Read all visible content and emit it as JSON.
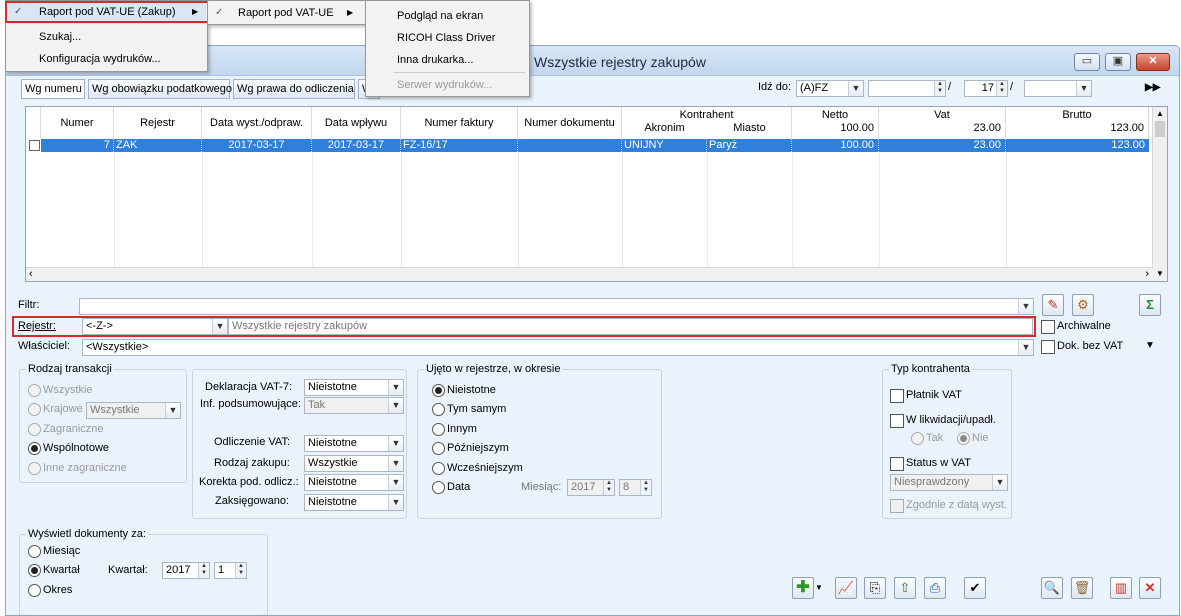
{
  "menu": {
    "level1": {
      "items": [
        {
          "label": "Raport pod VAT-UE (Zakup)",
          "arrow": "▶"
        },
        {
          "label": "Szukaj..."
        },
        {
          "label": "Konfiguracja wydruków..."
        }
      ]
    },
    "level2": {
      "items": [
        {
          "label": "Raport pod VAT-UE",
          "arrow": "▶"
        }
      ]
    },
    "level3": {
      "items": [
        {
          "label": "Podgląd na ekran"
        },
        {
          "label": "RICOH Class Driver"
        },
        {
          "label": "Inna drukarka..."
        },
        {
          "label": "Serwer wydruków..."
        }
      ]
    }
  },
  "window": {
    "title": "Wszystkie rejestry zakupów"
  },
  "tabs": [
    {
      "label": "Wg numeru"
    },
    {
      "label": "Wg obowiązku podatkowego"
    },
    {
      "label": "Wg prawa do odliczenia"
    },
    {
      "label": "W"
    }
  ],
  "goto": {
    "label": "Idź do:",
    "type_value": "(A)FZ",
    "sep1": "/",
    "number": "17",
    "sep2": "/"
  },
  "grid": {
    "headers": {
      "numer": "Numer",
      "rejestr": "Rejestr",
      "data_wyst": "Data wyst./odpraw.",
      "data_wplywu": "Data wpływu",
      "numer_faktury": "Numer faktury",
      "numer_dokumentu": "Numer dokumentu",
      "kontrahent": "Kontrahent",
      "akronim": "Akronim",
      "miasto": "Miasto",
      "netto": "Netto",
      "vat": "Vat",
      "brutto": "Brutto"
    },
    "totals": {
      "netto": "100.00",
      "vat": "23.00",
      "brutto": "123.00"
    },
    "rows": [
      {
        "numer": "7",
        "rejestr": "ZAK",
        "data_wyst": "2017-03-17",
        "data_wplywu": "2017-03-17",
        "numer_faktury": "FZ-16/17",
        "numer_dokumentu": "",
        "akronim": "UNIJNY",
        "miasto": "Paryż",
        "netto": "100.00",
        "vat": "23.00",
        "brutto": "123.00"
      }
    ]
  },
  "filter": {
    "filtr_label": "Filtr:",
    "filtr_value": "",
    "rejestr_label": "Rejestr:",
    "rejestr_value": "<-Z->",
    "rejestr_desc": "Wszystkie rejestry zakupów",
    "wlasciciel_label": "Właściciel:",
    "wlasciciel_value": "<Wszystkie>",
    "archiwalne": "Archiwalne",
    "dok_bez_vat": "Dok. bez VAT"
  },
  "rodzaj": {
    "title": "Rodzaj transakcji",
    "wszystkie": "Wszystkie",
    "krajowe": "Krajowe",
    "krajowe_select": "Wszystkie",
    "zagraniczne": "Zagraniczne",
    "wspolnotowe": "Wspólnotowe",
    "inne": "Inne zagraniczne"
  },
  "deklaracja": {
    "vat7_label": "Deklaracja VAT-7:",
    "vat7_value": "Nieistotne",
    "inf_label": "Inf. podsumowujące:",
    "inf_value": "Tak",
    "odliczenie_label": "Odliczenie VAT:",
    "odliczenie_value": "Nieistotne",
    "rodzaj_label": "Rodzaj zakupu:",
    "rodzaj_value": "Wszystkie",
    "korekta_label": "Korekta pod. odlicz.:",
    "korekta_value": "Nieistotne",
    "zaksiegowano_label": "Zaksięgowano:",
    "zaksiegowano_value": "Nieistotne"
  },
  "ujeto": {
    "title": "Ujęto w rejestrze, w okresie",
    "nieistotne": "Nieistotne",
    "tym": "Tym samym",
    "innym": "Innym",
    "pozniej": "Późniejszym",
    "wczesniej": "Wcześniejszym",
    "data": "Data",
    "miesiac_label": "Miesiąc:",
    "rok": "2017",
    "miesiac": "8"
  },
  "typ": {
    "title": "Typ kontrahenta",
    "platnik": "Płatnik VAT",
    "likwidacja": "W likwidacji/upadł.",
    "tak": "Tak",
    "nie": "Nie",
    "status": "Status w VAT",
    "status_value": "Niesprawdzony",
    "zgodnie": "Zgodnie z datą wyst."
  },
  "wyswietl": {
    "title": "Wyświetl dokumenty za:",
    "miesiac": "Miesiąc",
    "kwartal": "Kwartał",
    "okres": "Okres",
    "kwartal_label": "Kwartał:",
    "rok": "2017",
    "kwartal_value": "1"
  },
  "colors": {
    "accent": "#2f7fdd",
    "highlight_box": "#d42c2c",
    "window_bg": "#eaf2fb"
  }
}
